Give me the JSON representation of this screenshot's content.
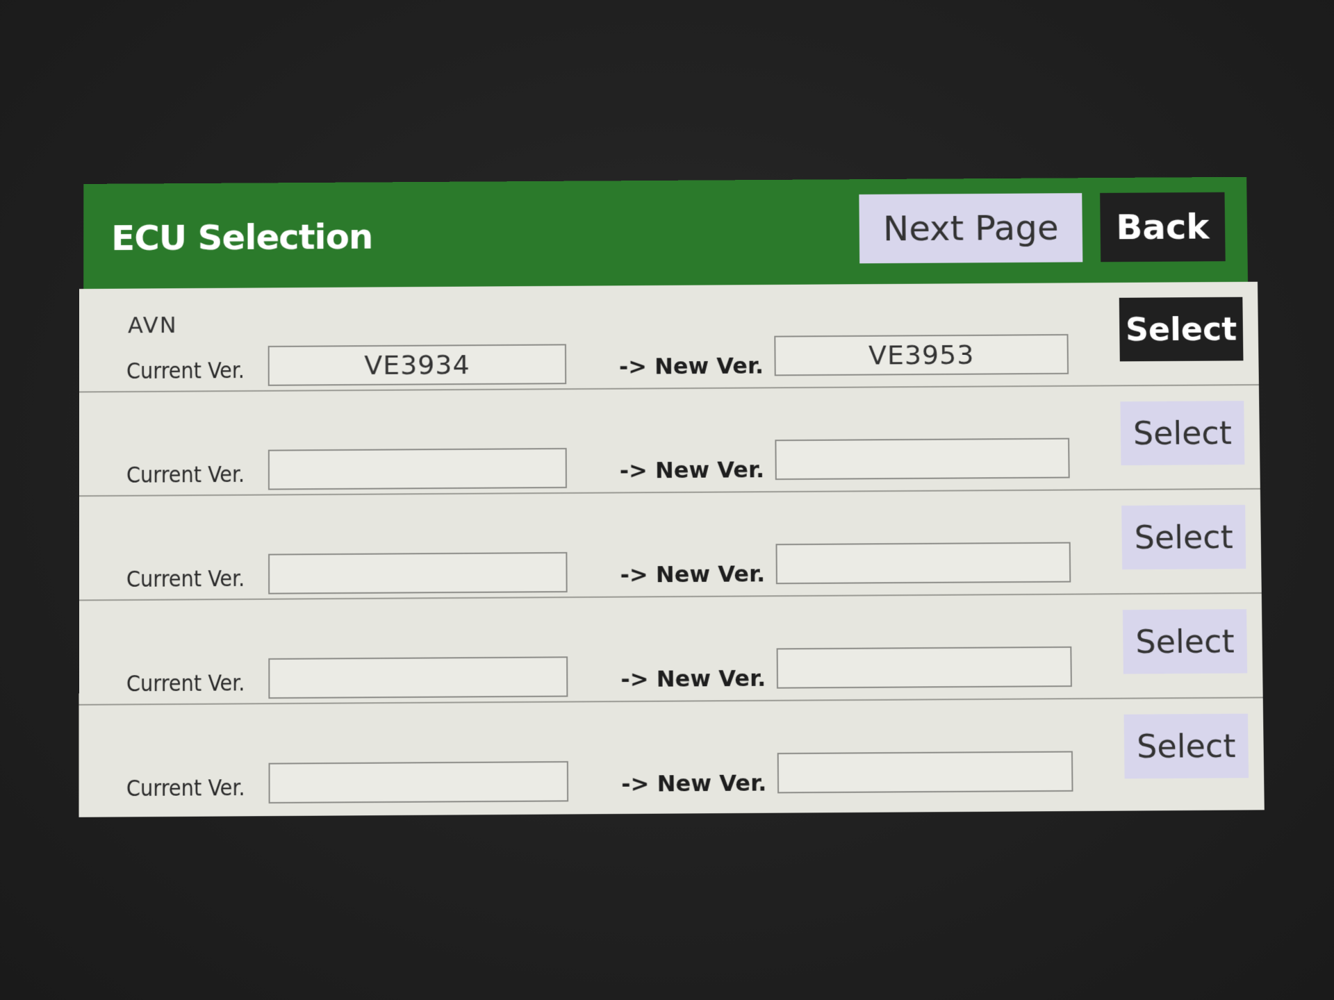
{
  "header": {
    "title": "ECU Selection",
    "next_page_label": "Next Page",
    "back_label": "Back"
  },
  "colors": {
    "header_bg": "#2b7a2b",
    "list_bg": "#e6e6df",
    "button_bg": "#d8d6ec",
    "active_button_bg": "#202020"
  },
  "labels": {
    "current_ver": "Current Ver.",
    "new_ver": "-> New Ver.",
    "select": "Select"
  },
  "rows": [
    {
      "name": "AVN",
      "current_version": "VE3934",
      "new_version": "VE3953",
      "selected": true
    },
    {
      "name": "",
      "current_version": "",
      "new_version": "",
      "selected": false
    },
    {
      "name": "",
      "current_version": "",
      "new_version": "",
      "selected": false
    },
    {
      "name": "",
      "current_version": "",
      "new_version": "",
      "selected": false
    },
    {
      "name": "",
      "current_version": "",
      "new_version": "",
      "selected": false
    }
  ]
}
